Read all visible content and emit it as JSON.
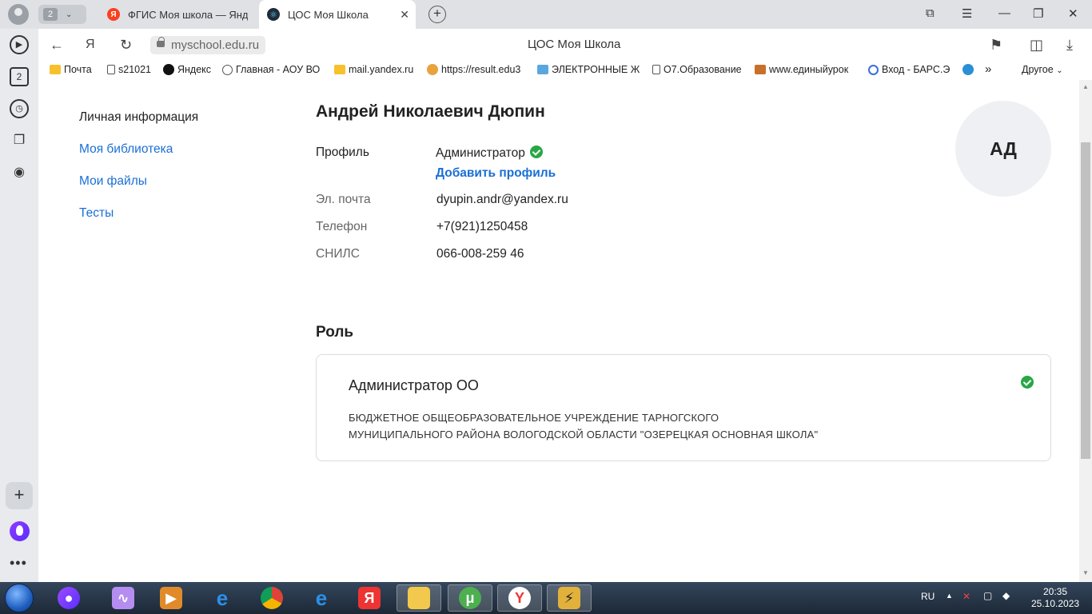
{
  "browser": {
    "tab_group_count": "2",
    "tabs": [
      {
        "title": "ФГИС Моя школа — Янде"
      },
      {
        "title": "ЦОС Моя Школа"
      }
    ],
    "url": "myschool.edu.ru",
    "page_title": "ЦОС Моя Школа",
    "bookmarks": [
      {
        "label": "Почта"
      },
      {
        "label": "s21021"
      },
      {
        "label": "Яндекс"
      },
      {
        "label": "Главная - АОУ ВО"
      },
      {
        "label": "mail.yandex.ru"
      },
      {
        "label": "https://result.edu3"
      },
      {
        "label": "ЭЛЕКТРОННЫЕ Ж"
      },
      {
        "label": "О7.Образование"
      },
      {
        "label": "www.единыйурок"
      },
      {
        "label": "Вход - БАРС.Э"
      }
    ],
    "bookmarks_more": "»",
    "bookmarks_other": "Другое"
  },
  "sidebar": {
    "badge_count": "2"
  },
  "nav": {
    "items": [
      "Личная информация",
      "Моя библиотека",
      "Мои файлы",
      "Тесты"
    ]
  },
  "user": {
    "name": "Андрей Николаевич Дюпин",
    "initials": "АД",
    "profile_label": "Профиль",
    "profile_value": "Администратор",
    "add_profile": "Добавить профиль",
    "email_label": "Эл. почта",
    "email": "dyupin.andr@yandex.ru",
    "phone_label": "Телефон",
    "phone": "+7(921)1250458",
    "snils_label": "СНИЛС",
    "snils": "066-008-259 46"
  },
  "role": {
    "heading": "Роль",
    "title": "Администратор ОО",
    "org_line1": "БЮДЖЕТНОЕ ОБЩЕОБРАЗОВАТЕЛЬНОЕ УЧРЕЖДЕНИЕ ТАРНОГСКОГО",
    "org_line2": "МУНИЦИПАЛЬНОГО РАЙОНА ВОЛОГОДСКОЙ ОБЛАСТИ \"ОЗЕРЕЦКАЯ ОСНОВНАЯ ШКОЛА\""
  },
  "taskbar": {
    "lang": "RU",
    "time": "20:35",
    "date": "25.10.2023"
  },
  "colors": {
    "link": "#1a6fd6",
    "success": "#28a745",
    "avatar_bg": "#eef0f3"
  }
}
